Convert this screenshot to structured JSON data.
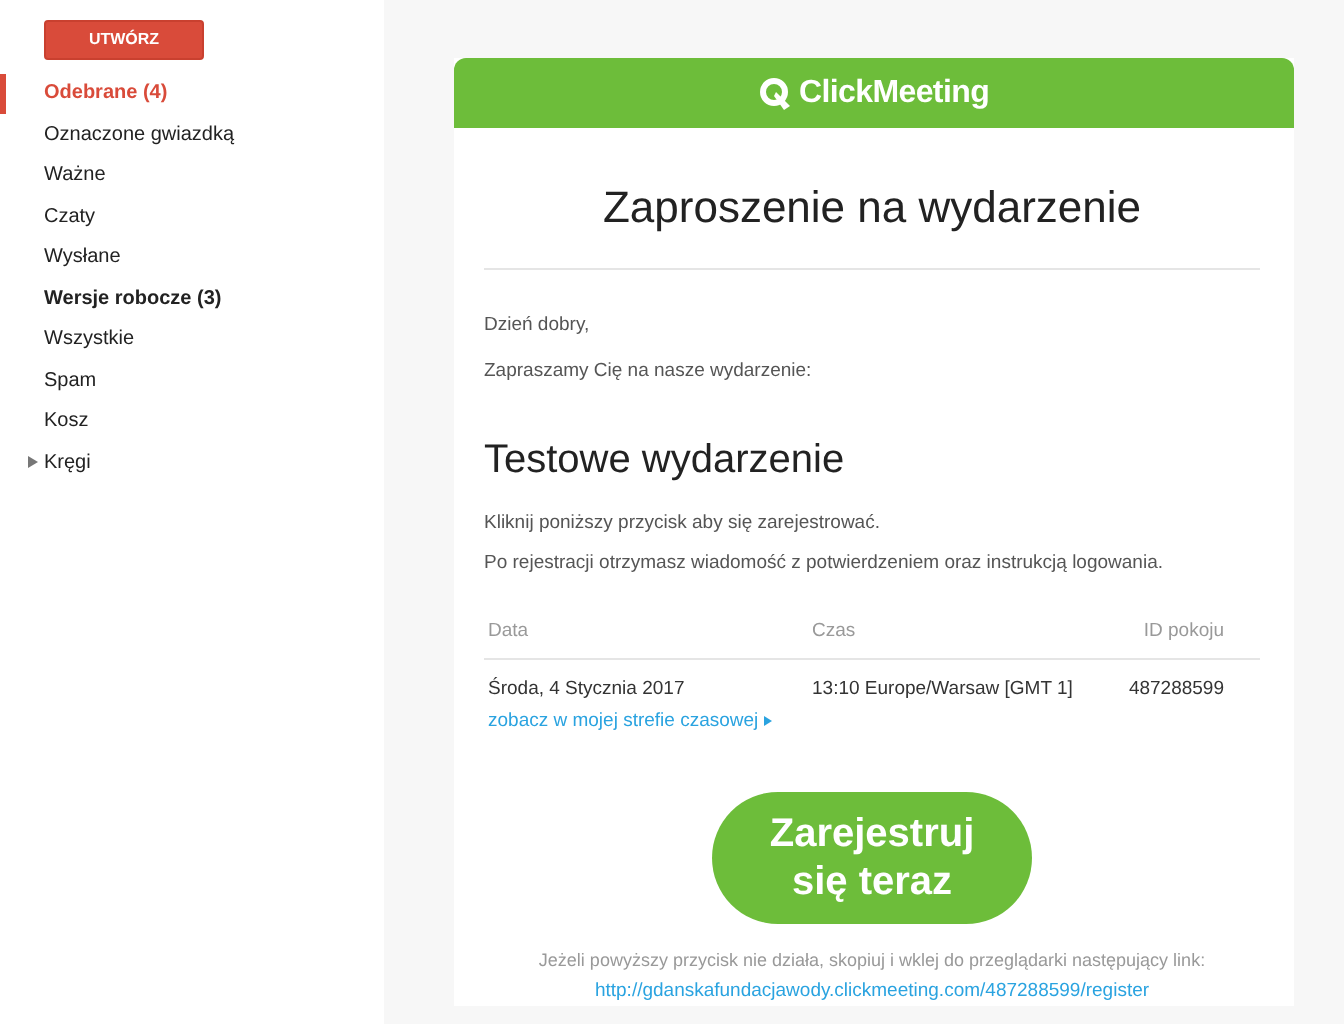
{
  "sidebar": {
    "compose_button": "UTWÓRZ",
    "items": [
      {
        "label": "Odebrane (4)",
        "selected": true,
        "unread": true,
        "kind": "folder"
      },
      {
        "label": "Oznaczone gwiazdką",
        "selected": false,
        "unread": false,
        "kind": "folder"
      },
      {
        "label": "Ważne",
        "selected": false,
        "unread": false,
        "kind": "folder"
      },
      {
        "label": "Czaty",
        "selected": false,
        "unread": false,
        "kind": "folder"
      },
      {
        "label": "Wysłane",
        "selected": false,
        "unread": false,
        "kind": "folder"
      },
      {
        "label": "Wersje robocze (3)",
        "selected": false,
        "unread": true,
        "kind": "folder"
      },
      {
        "label": "Wszystkie",
        "selected": false,
        "unread": false,
        "kind": "folder"
      },
      {
        "label": "Spam",
        "selected": false,
        "unread": false,
        "kind": "folder"
      },
      {
        "label": "Kosz",
        "selected": false,
        "unread": false,
        "kind": "folder"
      },
      {
        "label": "Kręgi",
        "selected": false,
        "unread": false,
        "kind": "group"
      }
    ]
  },
  "email": {
    "brand": "ClickMeeting",
    "title": "Zaproszenie na wydarzenie",
    "greeting": "Dzień dobry,",
    "intro": "Zapraszamy Cię na nasze wydarzenie:",
    "event_name": "Testowe wydarzenie",
    "instructions": [
      "Kliknij poniższy przycisk aby się zarejestrować.",
      "Po rejestracji otrzymasz wiadomość z potwierdzeniem oraz instrukcją logowania."
    ],
    "table": {
      "columns": [
        "Data",
        "Czas",
        "ID pokoju"
      ],
      "row": [
        "Środa, 4 Stycznia 2017",
        "13:10 Europe/Warsaw [GMT 1]",
        "487288599"
      ]
    },
    "timezone_link": "zobacz w mojej strefie czasowej",
    "register_button": "Zarejestruj się teraz",
    "fallback_text": "Jeżeli powyższy przycisk nie działa, skopiuj i wklej do przeglądarki następujący link:",
    "fallback_link": "http://gdanskafundacjawody.clickmeeting.com/487288599/register"
  }
}
